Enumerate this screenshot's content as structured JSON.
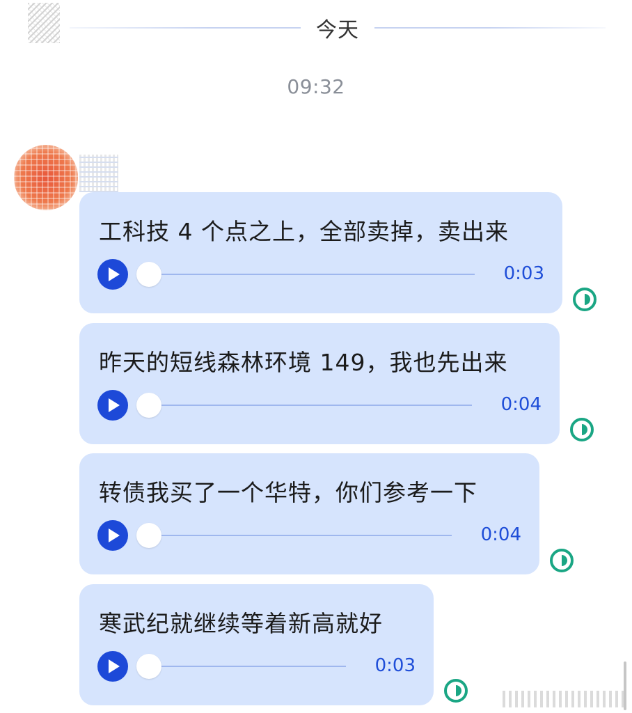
{
  "chat": {
    "date_label": "今天",
    "time_label": "09:32",
    "messages": [
      {
        "text": "工科技 4 个点之上，全部卖掉，卖出来",
        "duration": "0:03",
        "played_fraction": 0
      },
      {
        "text": "昨天的短线森林环境 149，我也先出来",
        "duration": "0:04",
        "played_fraction": 0
      },
      {
        "text": "转债我买了一个华特，你们参考一下",
        "duration": "0:04",
        "played_fraction": 0
      },
      {
        "text": "寒武纪就继续等着新高就好",
        "duration": "0:03",
        "played_fraction": 0
      }
    ]
  },
  "icons": {
    "play": "play-icon",
    "status": "half-circle-status-icon"
  },
  "colors": {
    "bubble_background": "#d6e4fd",
    "play_button": "#1d49d8",
    "duration_text": "#1f4ed8",
    "status_icon": "#1aa684",
    "time_text": "#8a8f98"
  }
}
